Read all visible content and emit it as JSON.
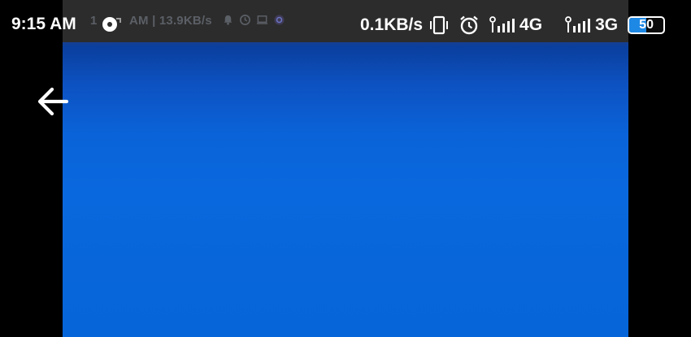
{
  "status_bar": {
    "time": "9:15 AM",
    "net_speed": "0.1KB/s",
    "signal1_label": "4G",
    "signal2_label": "3G",
    "battery_percent": "50",
    "battery_level": 0.5,
    "icons": [
      "sync-icon",
      "vibrate-icon",
      "alarm-icon",
      "signal-icon",
      "signal-icon",
      "battery-icon"
    ]
  },
  "background_capture": {
    "status_text": "AM | 13.9KB/s",
    "time_fragment": "1",
    "icons": [
      "bell-icon",
      "clock-icon",
      "laptop-icon",
      "record-icon"
    ]
  },
  "navigation": {
    "back_icon": "arrow-left-icon"
  },
  "colors": {
    "content_blue": "#0a68de",
    "status_bar_bg": "#000000",
    "battery_accent": "#1e88e5",
    "text": "#ffffff"
  }
}
